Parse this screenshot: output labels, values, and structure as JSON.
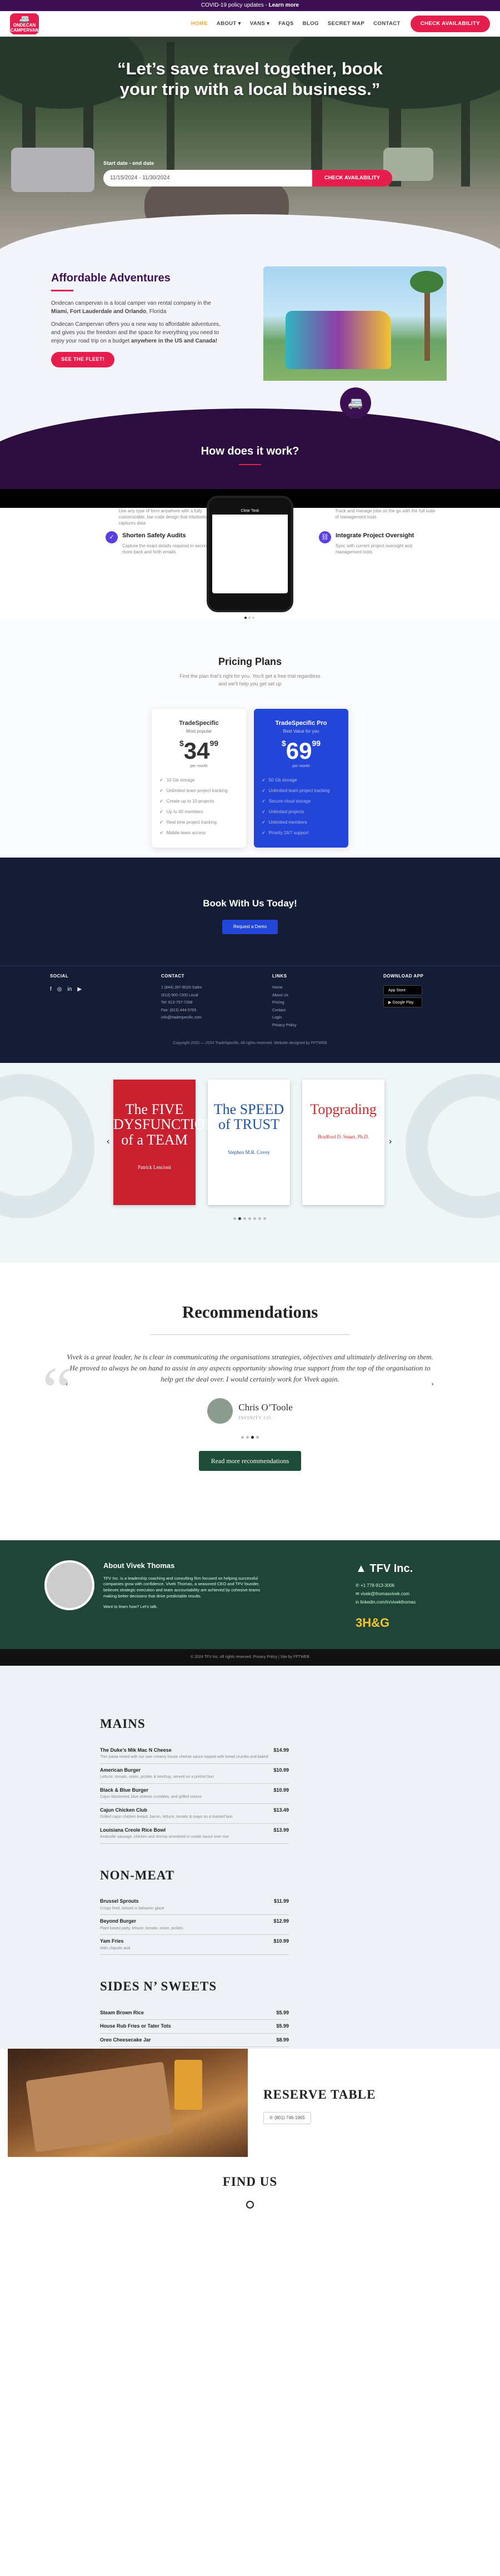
{
  "topbar": {
    "text": "COVID-19 policy updates",
    "sep": " - ",
    "link": "Learn more"
  },
  "header": {
    "logo": {
      "line1": "ONDECAN",
      "line2": "CAMPERVAN"
    },
    "nav": [
      "Home",
      "About",
      "Vans",
      "FAQs",
      "Blog",
      "Secret Map",
      "Contact"
    ],
    "nav_active": "Home",
    "cta": "Check Availability"
  },
  "hero": {
    "headline": "“Let’s save travel together, book your trip with a local business.”",
    "date_label": "Start date - end date",
    "date_value": "11/15/2024 - 11/30/2024",
    "button": "Check Availability"
  },
  "affordable": {
    "title": "Affordable Adventures",
    "p1_pre": "Ondecan campervan is a local camper van rental company in the ",
    "p1_bold": "Miami, Fort Lauderdale and Orlando",
    "p1_post": ", Florida",
    "p2_pre": "Ondecan Campervan offers you a new way to affordable adventures, and gives you the freedom and the space for everything you need to enjoy your road trip on a budget ",
    "p2_bold": "anywhere in the US and Canada!",
    "button": "See the fleet!"
  },
  "how": {
    "title": "How does it work?"
  },
  "features": {
    "left_top_desc": "Use any type of form anywhere with a fully customizable, bar-code design that intuitively captures data",
    "left_title": "Shorten Safety Audits",
    "left_desc": "Capture the exact details required in seconds, no more back and forth emails",
    "right_top_desc": "Track and manage jobs on the go with the full suite of management tools",
    "right_title": "Integrate Project Oversight",
    "right_desc": "Sync with current project oversight and management tools",
    "phone_title": "Clear Task"
  },
  "pricing": {
    "title": "Pricing Plans",
    "subtitle": "Find the plan that's right for you. You'll get a free trial regardless and we'll help you get set up",
    "plans": [
      {
        "name": "TradeSpecific",
        "tagline": "Most popular",
        "dollars": "34",
        "cents": "99",
        "period": "per month",
        "features": [
          "10 Gb storage",
          "Unlimited team project tracking",
          "Create up to 10 projects",
          "Up to 40 members",
          "Real time project tracking",
          "Mobile team access"
        ]
      },
      {
        "name": "TradeSpecific Pro",
        "tagline": "Best Value for you",
        "dollars": "69",
        "cents": "99",
        "period": "per month",
        "features": [
          "50 Gb storage",
          "Unlimited team project tracking",
          "Secure cloud storage",
          "Unlimited projects",
          "Unlimited members",
          "Priority 24/7 support"
        ]
      }
    ]
  },
  "cta": {
    "title": "Book With Us Today!",
    "button": "Request a Demo"
  },
  "footer": {
    "social_title": "SOCIAL",
    "contact_title": "CONTACT",
    "contact": [
      "1 (844) 287-8020 Sales",
      "(813) 900-7200 Local",
      "Tel: 813-757-7268",
      "Fax: (813) 444-5765",
      "info@tradespecific.com"
    ],
    "links_title": "LINKS",
    "links": [
      "Home",
      "About Us",
      "Pricing",
      "Contact",
      "Login",
      "Privacy Policy"
    ],
    "download_title": "DOWNLOAD APP",
    "app_store": "App Store",
    "google_play": "Google Play",
    "copyright": "Copyright 2020 — 2024 TradeSpecific. All rights reserved. Website designed by FFTWEB"
  },
  "books": [
    {
      "title": "The FIVE DYSFUNCTIONS of a TEAM",
      "author": "Patrick Lencioni",
      "bg": "#c8202f",
      "fg": "#ffffff"
    },
    {
      "title": "The SPEED of TRUST",
      "author": "Stephen M.R. Covey",
      "bg": "#ffffff",
      "fg": "#1a55a8"
    },
    {
      "title": "Topgrading",
      "author": "Bradford D. Smart, Ph.D.",
      "bg": "#ffffff",
      "fg": "#d12a2a"
    }
  ],
  "recommendations": {
    "title": "Recommendations",
    "quote": "Vivek is a great leader, he is clear in communicating the organisations strategies, objectives and ultimately delivering on them. He proved to always be on hand to assist in any aspects opportunity showing true support from the top of the organisation to help get the deal over. I would certainly work for Vivek again.",
    "author": "Chris O’Toole",
    "company": "INFINITY CO.",
    "button": "Read more recommendations"
  },
  "about": {
    "title": "About Vivek Thomas",
    "bio": "TFV Inc. is a leadership coaching and consulting firm focused on helping successful companies grow with confidence. Vivek Thomas, a seasoned CEO and TFV founder, believes strategic execution and team accountability are achieved by cohesive teams making better decisions that drive predictable results.",
    "cta": "Want to learn how? Let's talk.",
    "brand": "TFV Inc.",
    "phone": "+1 778-913-3006",
    "email": "vivek@thomasvivek.com",
    "linkedin": "linkedin.com/in/vivekthomas",
    "hg": "3H&G",
    "copyright": "© 2024 TFV Inc. All rights reserved. Privacy Policy | Site by FFTWEB"
  },
  "menu": {
    "sections": [
      {
        "title": "MAINS",
        "items": [
          {
            "name": "The Duke’s Mik Mac N Cheese",
            "price": "$14.99",
            "desc": "Thin pasta mixed with our own creamy house cheese sauce topped with bread crumbs and baked"
          },
          {
            "name": "American Burger",
            "price": "$10.99",
            "desc": "Lettuce, tomato, onion, pickles & ketchup, served on a pretzel bun"
          },
          {
            "name": "Black & Blue Burger",
            "price": "$10.99",
            "desc": "Cajun blackened, blue cheese crumbles, and grilled onions"
          },
          {
            "name": "Cajun Chicken Club",
            "price": "$13.49",
            "desc": "Grilled cajun chicken breast, bacon, lettuce, tomato & mayo on a toasted bun"
          },
          {
            "name": "Louisiana Creole Rice Bowl",
            "price": "$13.99",
            "desc": "Andouille sausage, chicken and shrimp simmered in creole sauce over rice"
          }
        ]
      },
      {
        "title": "NON-MEAT",
        "items": [
          {
            "name": "Brussel Sprouts",
            "price": "$11.99",
            "desc": "Crispy fried, tossed in balsamic glaze"
          },
          {
            "name": "Beyond Burger",
            "price": "$12.99",
            "desc": "Plant based patty, lettuce, tomato, onion, pickles"
          },
          {
            "name": "Yam Fries",
            "price": "$10.99",
            "desc": "With chipotle aioli"
          }
        ]
      },
      {
        "title": "SIDES N’ SWEETS",
        "items": [
          {
            "name": "Steam Brown Rice",
            "price": "$5.99",
            "desc": ""
          },
          {
            "name": "House Rub Fries or Tater Tots",
            "price": "$5.99",
            "desc": ""
          },
          {
            "name": "Oreo Cheesecake Jar",
            "price": "$8.99",
            "desc": ""
          }
        ]
      }
    ]
  },
  "reserve": {
    "title": "RESERVE TABLE",
    "phone": "(801) 746-1965"
  },
  "findus": {
    "title": "FIND US"
  }
}
